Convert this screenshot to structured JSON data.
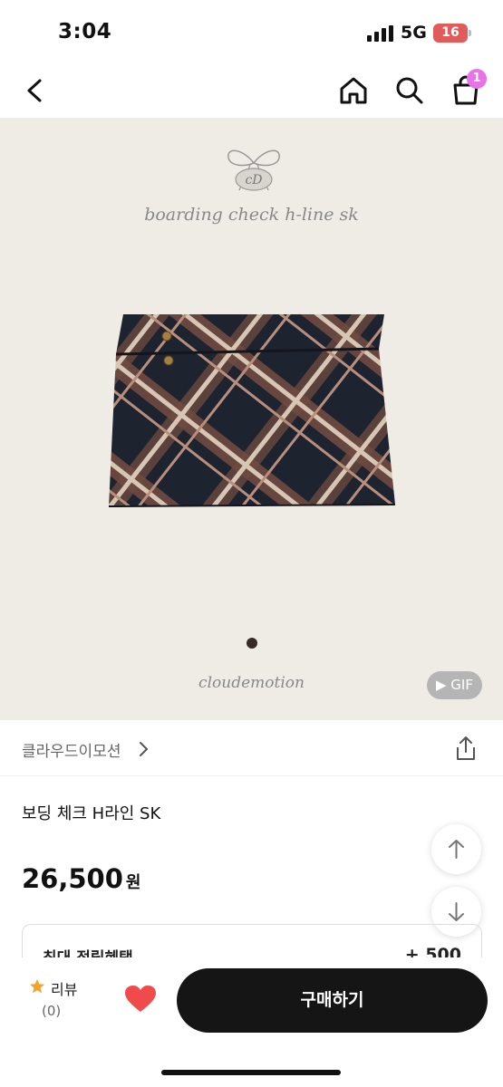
{
  "status_bar": {
    "time": "3:04",
    "network": "5G",
    "battery": "16"
  },
  "nav": {
    "cart_count": "1"
  },
  "hero": {
    "product_script": "boarding check h-line sk",
    "brand_script": "cloudemotion",
    "gif_label": "▶ GIF"
  },
  "seller": {
    "name": "클라우드이모션"
  },
  "product": {
    "title": "보딩 체크 H라인 SK",
    "price": "26,500",
    "currency": "원"
  },
  "benefit": {
    "label": "최대 적립혜택",
    "value": "+ 500"
  },
  "bottom_bar": {
    "review_label": "리뷰",
    "review_count": "(0)",
    "buy_label": "구매하기"
  },
  "colors": {
    "accent_badge": "#e873e8",
    "heart": "#f04a4a",
    "star": "#f3a32a",
    "buy_bg": "#151515"
  }
}
